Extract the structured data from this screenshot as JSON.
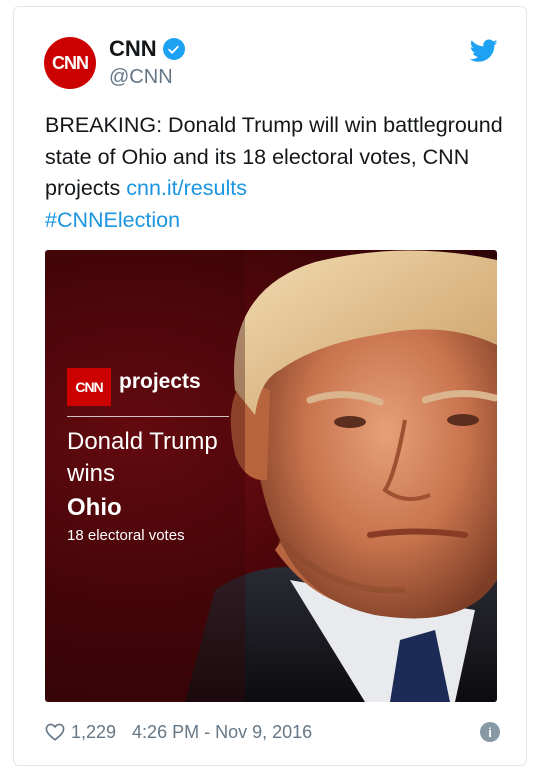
{
  "account": {
    "name": "CNN",
    "handle": "@CNN",
    "avatar_text": "CNN",
    "verified": true
  },
  "tweet": {
    "text_main": "BREAKING: Donald Trump will win battleground state of Ohio and its 18 electoral votes, CNN projects ",
    "link": "cnn.it/results",
    "hashtag": "#CNNElection"
  },
  "media": {
    "badge_text": "CNN",
    "projects_label": "projects",
    "headline_line1": "Donald Trump",
    "headline_line2": "wins",
    "state": "Ohio",
    "electoral_votes": "18 electoral votes"
  },
  "footer": {
    "likes": "1,229",
    "timestamp": "4:26 PM - Nov 9, 2016",
    "info_glyph": "i"
  },
  "icons": [
    "twitter-bird-icon",
    "verified-icon",
    "heart-icon",
    "info-icon"
  ],
  "colors": {
    "cnn_red": "#cc0000",
    "link_blue": "#1b95e0",
    "twitter_blue": "#1da1f2",
    "text": "#14171a",
    "muted": "#657786"
  }
}
